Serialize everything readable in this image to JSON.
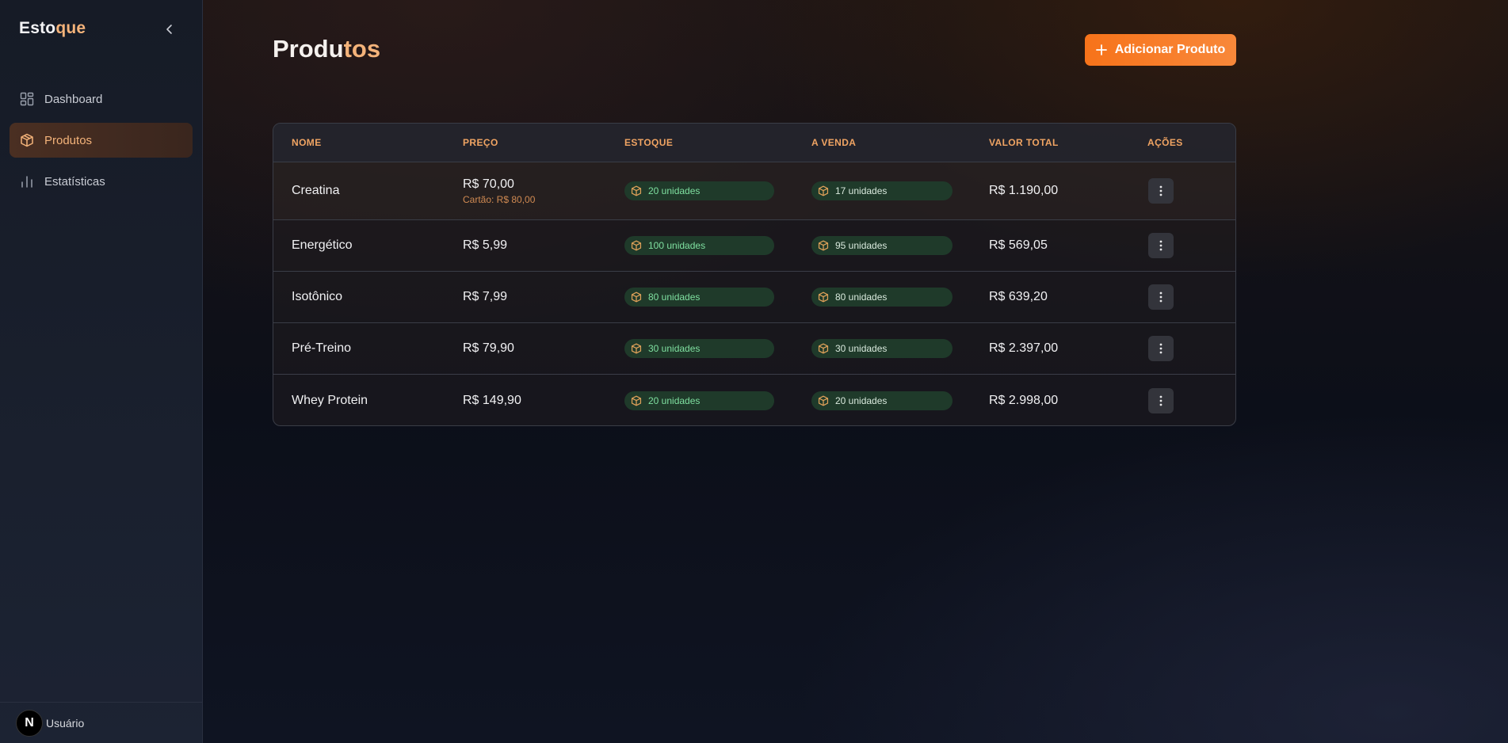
{
  "brand": {
    "part1": "Esto",
    "part2": "que"
  },
  "sidebar": {
    "items": [
      {
        "label": "Dashboard",
        "icon": "grid-icon",
        "active": false
      },
      {
        "label": "Produtos",
        "icon": "box-icon",
        "active": true
      },
      {
        "label": "Estatísticas",
        "icon": "bar-chart-icon",
        "active": false
      }
    ],
    "user": {
      "avatar_letter": "N",
      "name": "Usuário"
    }
  },
  "header": {
    "title_part1": "Produ",
    "title_part2": "tos",
    "add_button_label": "Adicionar Produto"
  },
  "table": {
    "columns": [
      "NOME",
      "PREÇO",
      "ESTOQUE",
      "A VENDA",
      "VALOR TOTAL",
      "AÇÕES"
    ],
    "rows": [
      {
        "name": "Creatina",
        "price": "R$ 70,00",
        "price_card": "Cartão: R$ 80,00",
        "stock": "20 unidades",
        "sale": "17 unidades",
        "total": "R$ 1.190,00"
      },
      {
        "name": "Energético",
        "price": "R$ 5,99",
        "price_card": "",
        "stock": "100 unidades",
        "sale": "95 unidades",
        "total": "R$ 569,05"
      },
      {
        "name": "Isotônico",
        "price": "R$ 7,99",
        "price_card": "",
        "stock": "80 unidades",
        "sale": "80 unidades",
        "total": "R$ 639,20"
      },
      {
        "name": "Pré-Treino",
        "price": "R$ 79,90",
        "price_card": "",
        "stock": "30 unidades",
        "sale": "30 unidades",
        "total": "R$ 2.397,00"
      },
      {
        "name": "Whey Protein",
        "price": "R$ 149,90",
        "price_card": "",
        "stock": "20 unidades",
        "sale": "20 unidades",
        "total": "R$ 2.998,00"
      }
    ]
  },
  "colors": {
    "accent": "#f7731a",
    "accent_text": "#f4b37a",
    "pill_bg": "#1f3a2a",
    "pill_text": "#7fe0a0"
  }
}
